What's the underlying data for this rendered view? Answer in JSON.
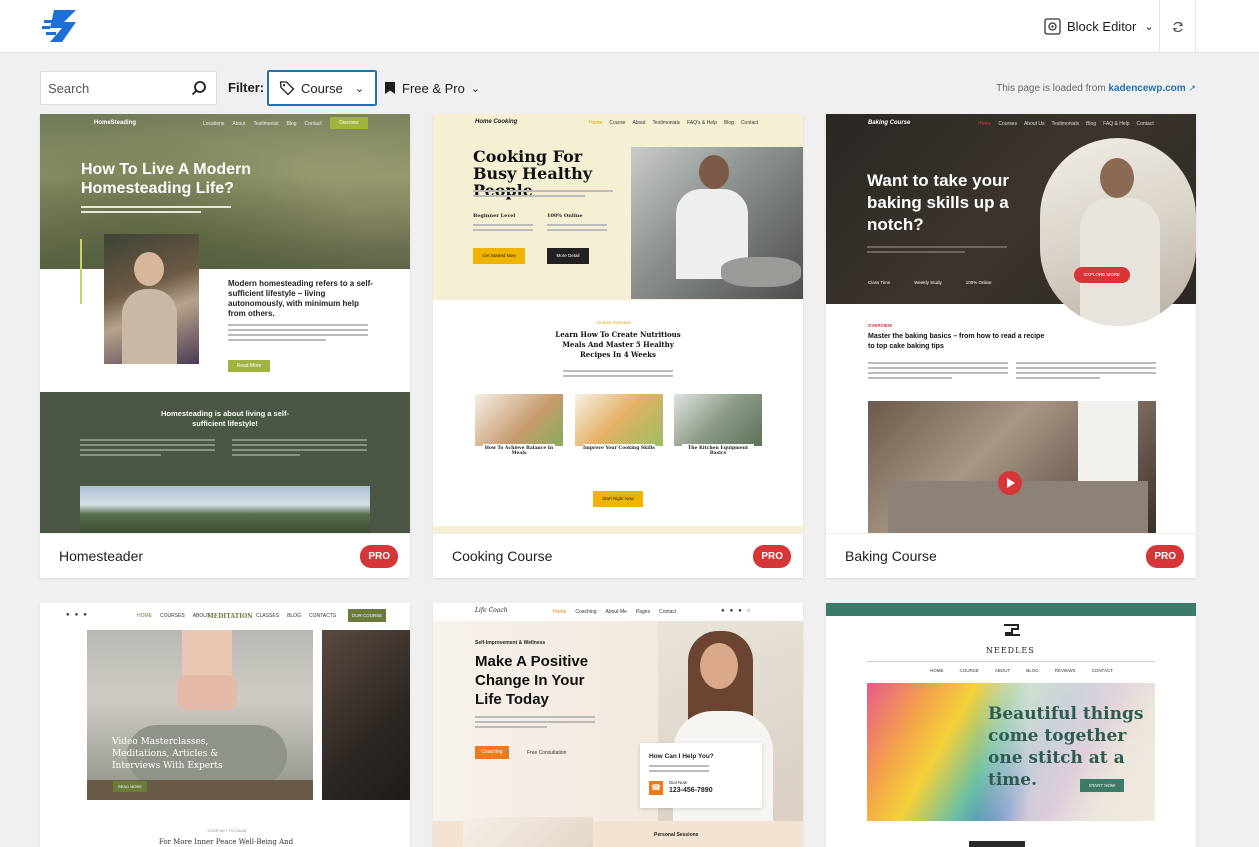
{
  "topbar": {
    "editor_label": "Block Editor",
    "editor_icon": "block-editor-icon",
    "sync_icon": "sync-icon"
  },
  "filters": {
    "search_placeholder": "Search",
    "filter_label": "Filter:",
    "category": "Course",
    "tier": "Free & Pro",
    "loaded_prefix": "This page is loaded from",
    "loaded_link": "kadencewp.com"
  },
  "cards": [
    {
      "title": "Homesteader",
      "badge": "PRO",
      "preview": {
        "brand": "HomeSteading",
        "nav": [
          "Locations",
          "About",
          "Testimonial",
          "Blog",
          "Contact"
        ],
        "cta": "Discover",
        "hero_title": "How To Live A Modern Homesteading Life?",
        "sub_heading": "Modern homesteading refers to a self-sufficient lifestyle – living autonomously, with minimum help from others.",
        "button": "Read More",
        "band_title": "Homesteading is about living a self-sufficient lifestyle!"
      }
    },
    {
      "title": "Cooking Course",
      "badge": "PRO",
      "preview": {
        "brand": "Home Cooking",
        "nav": [
          "Home",
          "Course",
          "About",
          "Testimonials",
          "FAQ's & Help",
          "Blog",
          "Contact"
        ],
        "hero_title": "Cooking For Busy Healthy People",
        "level_label": "Beginner Level",
        "online_label": "100% Online",
        "btn_primary": "Get Started Now",
        "btn_secondary": "More Detail",
        "overview_label": "Course overview",
        "section_title": "Learn How To Create Nutritious Meals And Master 5 Healthy Recipes In 4 Weeks",
        "tiles": [
          "How To Achieve Balance In Meals",
          "Improve Your Cooking Skills",
          "The Kitchen Equipment Basics"
        ],
        "bottom_button": "Start Right Now"
      }
    },
    {
      "title": "Baking Course",
      "badge": "PRO",
      "preview": {
        "brand": "Baking Course",
        "nav": [
          "Home",
          "Courses",
          "About Us",
          "Testimonials",
          "Blog",
          "FAQ & Help",
          "Contact"
        ],
        "hero_title": "Want to take your baking skills up a notch?",
        "explore": "EXPLORE MORE",
        "stats": [
          "Class Time",
          "Weekly Study",
          "100% Online"
        ],
        "overview_label": "OVERVIEW",
        "section_title": "Master the baking basics – from how to read a recipe to top cake baking tips"
      }
    },
    {
      "title": "Meditation",
      "badge": "",
      "preview": {
        "brand": "MEDITATION",
        "nav": [
          "HOME",
          "COURSES",
          "ABOUT",
          "CLASSES",
          "BLOG",
          "CONTACTS"
        ],
        "cta": "OUR COURSE",
        "hero_title": "Video Masterclasses, Meditations, Articles & Interviews With Experts",
        "button": "READ MORE",
        "kicker": "YOUR KEY TO CALM",
        "footer_line": "For More Inner Peace Well-Being And"
      }
    },
    {
      "title": "Life Coaching",
      "badge": "",
      "preview": {
        "brand": "Life Coach",
        "nav": [
          "Home",
          "Coaching",
          "About Me",
          "Pages",
          "Contact"
        ],
        "kicker": "Self-Improvement & Wellness",
        "hero_title": "Make A Positive Change In Your Life Today",
        "btn_primary": "Coaching",
        "btn_secondary": "Free Consultation",
        "help_title": "How Can I Help You?",
        "dial_label": "Dial Now",
        "phone": "123-456-7890",
        "bottom_label": "Personal Sessions"
      }
    },
    {
      "title": "Needles",
      "badge": "",
      "preview": {
        "brand": "NEEDLES",
        "nav": [
          "HOME",
          "COURSE",
          "ABOUT",
          "BLOG",
          "REVIEWS",
          "CONTACT"
        ],
        "hero_title": "Beautiful things come together one stitch at a time.",
        "button": "START NOW"
      }
    }
  ]
}
